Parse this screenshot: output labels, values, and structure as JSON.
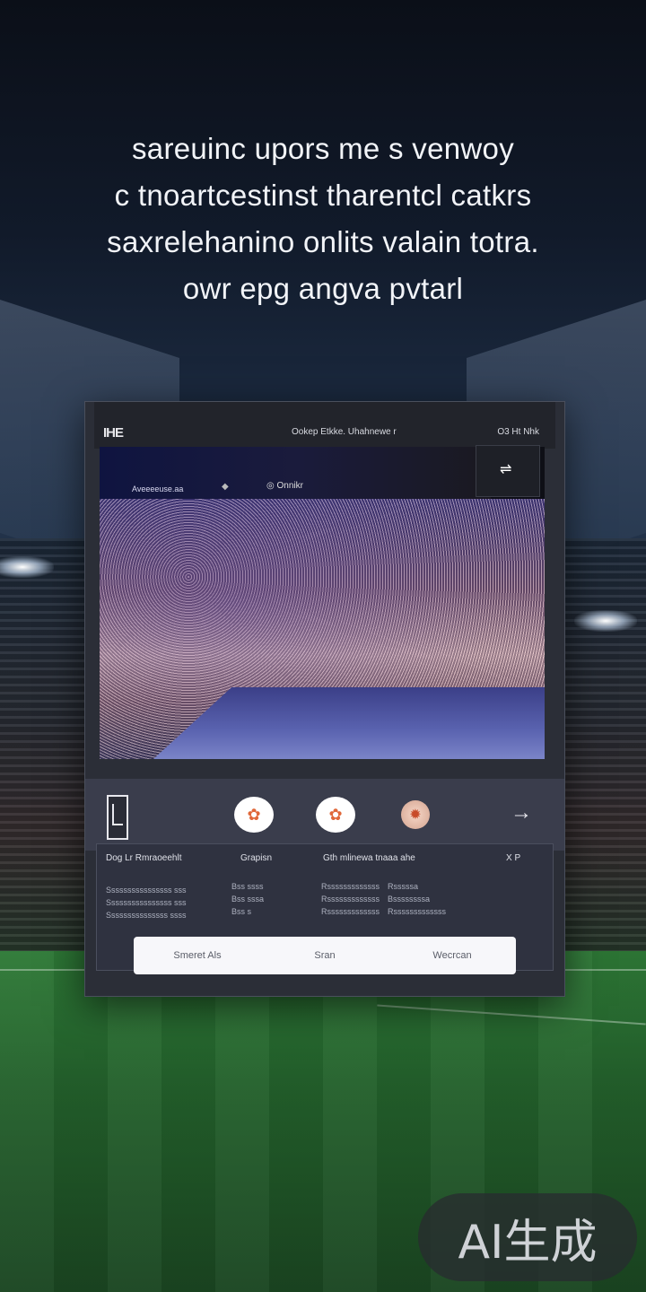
{
  "headline": {
    "lines": [
      "sareuinc upors me s venwoy",
      "c tnoartcestinst tharentcl catkrs",
      "saxrelehanino onlits valain totra.",
      "owr epg angva pvtarl"
    ]
  },
  "panel": {
    "logo": "IHE",
    "nav_center": "Ookep  Etkke.  Uhahnewe r",
    "nav_right": "O3  Ht  Nhk",
    "close_icon": "⇌",
    "video": {
      "broadcaster": "Aveeeeuse.aa",
      "dot_icon": "◆",
      "mini_logo": "◎ Onnikr"
    },
    "controls": {
      "button_1": "✿",
      "button_2": "✿",
      "button_3": "✹",
      "arrow": "→"
    },
    "stats": {
      "headers": [
        "Dog  Lr Rmraoeehlt",
        "Grapisn",
        "Gth mlinewa  tnaaa ahe",
        "X   P"
      ],
      "col1": [
        "Ssssssssssssssss sss",
        "Ssssssssssssssss sss",
        "Sssssssssssssss ssss"
      ],
      "col2": [
        "Bss ssss",
        "Bss sssa",
        "Bss s"
      ],
      "col3": [
        "Rsssssssssssss",
        "Rsssssssssssss",
        "Rsssssssssssss"
      ],
      "col4": [
        "Rsssssa",
        "Bssssssssa",
        "Rsssssssssssss"
      ]
    },
    "actions": [
      "Smeret  Als",
      "Sran",
      "Wecrcan"
    ]
  },
  "watermark": "AI生成"
}
